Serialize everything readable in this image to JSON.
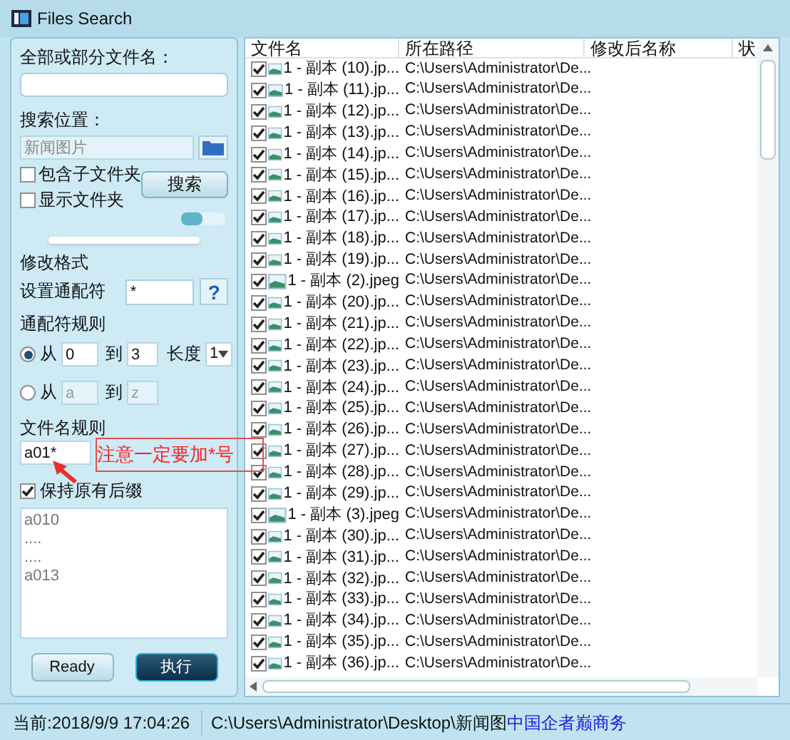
{
  "window": {
    "title": "Files Search"
  },
  "search": {
    "name_label": "全部或部分文件名：",
    "location_label": "搜索位置：",
    "location_placeholder": "新闻图片",
    "options": [
      {
        "label": "包含子文件夹",
        "checked": false
      },
      {
        "label": "显示文件夹",
        "checked": false
      }
    ],
    "search_button": "搜索"
  },
  "format": {
    "title": "修改格式",
    "wildcard_label": "设置通配符",
    "wildcard_value": "*",
    "help_button": "?"
  },
  "rules": {
    "title": "通配符规则",
    "ranges": [
      {
        "selected": true,
        "from_label": "从",
        "from": "0",
        "to_label": "到",
        "to": "3",
        "length_label": "长度",
        "length": "1"
      },
      {
        "selected": false,
        "from_label": "从",
        "from": "a",
        "to_label": "到",
        "to": "z"
      }
    ]
  },
  "filename_rule": {
    "title": "文件名规则",
    "value": "a01*"
  },
  "annotation": {
    "text": "注意一定要加*号"
  },
  "keep_suffix": {
    "label": "保持原有后缀",
    "checked": true
  },
  "preview_lines": [
    "a010",
    "....",
    "....",
    "a013"
  ],
  "buttons": [
    {
      "label": "Ready",
      "kind": "plain"
    },
    {
      "label": "执行",
      "kind": "primary"
    }
  ],
  "table": {
    "columns": [
      "文件名",
      "所在路径",
      "修改后名称",
      "状"
    ],
    "rows": [
      {
        "checked": true,
        "name": "1 - 副本 (10).jp...",
        "path": "C:\\Users\\Administrator\\De..."
      },
      {
        "checked": true,
        "name": "1 - 副本 (11).jp...",
        "path": "C:\\Users\\Administrator\\De..."
      },
      {
        "checked": true,
        "name": "1 - 副本 (12).jp...",
        "path": "C:\\Users\\Administrator\\De..."
      },
      {
        "checked": true,
        "name": "1 - 副本 (13).jp...",
        "path": "C:\\Users\\Administrator\\De..."
      },
      {
        "checked": true,
        "name": "1 - 副本 (14).jp...",
        "path": "C:\\Users\\Administrator\\De..."
      },
      {
        "checked": true,
        "name": "1 - 副本 (15).jp...",
        "path": "C:\\Users\\Administrator\\De..."
      },
      {
        "checked": true,
        "name": "1 - 副本 (16).jp...",
        "path": "C:\\Users\\Administrator\\De..."
      },
      {
        "checked": true,
        "name": "1 - 副本 (17).jp...",
        "path": "C:\\Users\\Administrator\\De..."
      },
      {
        "checked": true,
        "name": "1 - 副本 (18).jp...",
        "path": "C:\\Users\\Administrator\\De..."
      },
      {
        "checked": true,
        "name": "1 - 副本 (19).jp...",
        "path": "C:\\Users\\Administrator\\De..."
      },
      {
        "checked": true,
        "name": "1 - 副本 (2).jpeg",
        "path": "C:\\Users\\Administrator\\De..."
      },
      {
        "checked": true,
        "name": "1 - 副本 (20).jp...",
        "path": "C:\\Users\\Administrator\\De..."
      },
      {
        "checked": true,
        "name": "1 - 副本 (21).jp...",
        "path": "C:\\Users\\Administrator\\De..."
      },
      {
        "checked": true,
        "name": "1 - 副本 (22).jp...",
        "path": "C:\\Users\\Administrator\\De..."
      },
      {
        "checked": true,
        "name": "1 - 副本 (23).jp...",
        "path": "C:\\Users\\Administrator\\De..."
      },
      {
        "checked": true,
        "name": "1 - 副本 (24).jp...",
        "path": "C:\\Users\\Administrator\\De..."
      },
      {
        "checked": true,
        "name": "1 - 副本 (25).jp...",
        "path": "C:\\Users\\Administrator\\De..."
      },
      {
        "checked": true,
        "name": "1 - 副本 (26).jp...",
        "path": "C:\\Users\\Administrator\\De..."
      },
      {
        "checked": true,
        "name": "1 - 副本 (27).jp...",
        "path": "C:\\Users\\Administrator\\De..."
      },
      {
        "checked": true,
        "name": "1 - 副本 (28).jp...",
        "path": "C:\\Users\\Administrator\\De..."
      },
      {
        "checked": true,
        "name": "1 - 副本 (29).jp...",
        "path": "C:\\Users\\Administrator\\De..."
      },
      {
        "checked": true,
        "name": "1 - 副本 (3).jpeg",
        "path": "C:\\Users\\Administrator\\De..."
      },
      {
        "checked": true,
        "name": "1 - 副本 (30).jp...",
        "path": "C:\\Users\\Administrator\\De..."
      },
      {
        "checked": true,
        "name": "1 - 副本 (31).jp...",
        "path": "C:\\Users\\Administrator\\De..."
      },
      {
        "checked": true,
        "name": "1 - 副本 (32).jp...",
        "path": "C:\\Users\\Administrator\\De..."
      },
      {
        "checked": true,
        "name": "1 - 副本 (33).jp...",
        "path": "C:\\Users\\Administrator\\De..."
      },
      {
        "checked": true,
        "name": "1 - 副本 (34).jp...",
        "path": "C:\\Users\\Administrator\\De..."
      },
      {
        "checked": true,
        "name": "1 - 副本 (35).jp...",
        "path": "C:\\Users\\Administrator\\De..."
      },
      {
        "checked": true,
        "name": "1 - 副本 (36).jp...",
        "path": "C:\\Users\\Administrator\\De..."
      }
    ]
  },
  "status_bar": {
    "time": "当前:2018/9/9 17:04:26",
    "path": "C:\\Users\\Administrator\\Desktop\\新闻图",
    "ticker": "中国企者巅商务"
  }
}
